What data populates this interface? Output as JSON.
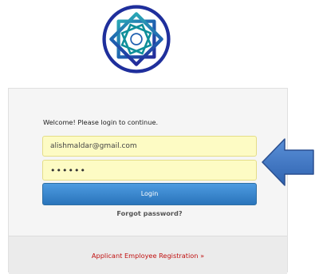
{
  "login": {
    "welcome_text": "Welcome! Please login to continue.",
    "email_value": "alishmaldar@gmail.com",
    "password_value": "••••••",
    "login_button": "Login",
    "forgot_password": "Forgot password?"
  },
  "footer": {
    "register_link": "Applicant Employee Registration »"
  },
  "colors": {
    "field_background": "#fdfbc4",
    "button_primary": "#2a74bb",
    "link_red": "#c01010",
    "arrow_blue": "#3f78c6"
  },
  "icons": [
    "logo-emblem-icon",
    "pointer-arrow-icon"
  ]
}
